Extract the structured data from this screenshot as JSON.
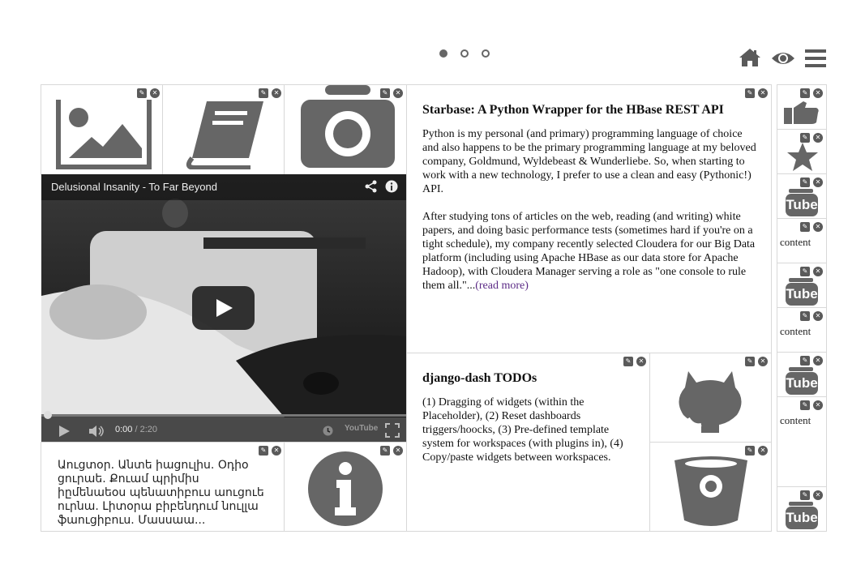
{
  "pager": {
    "dots": [
      "slide-1",
      "slide-2",
      "slide-3"
    ],
    "active": 0
  },
  "topbar": {
    "icons": [
      "home-icon",
      "eye-icon",
      "menu-icon"
    ]
  },
  "controls": {
    "edit_glyph": "✎",
    "remove_glyph": "✕"
  },
  "video": {
    "title": "Delusional Insanity - To Far Beyond",
    "time_current": "0:00",
    "time_separator": " / ",
    "time_total": "2:20",
    "brand": "YouTube"
  },
  "article1": {
    "title": "Starbase: A Python Wrapper for the HBase REST API",
    "para1": "Python is my personal (and primary) programming language of choice and also happens to be the primary programming language at my beloved company, Goldmund, Wyldebeast & Wunderliebe. So, when starting to work with a new technology, I prefer to use a clean and easy (Pythonic!) API.",
    "para2": "After studying tons of articles on the web, reading (and writing) white papers, and doing basic performance tests (sometimes hard if you're on a tight schedule), my company recently selected Cloudera for our Big Data platform (including using Apache HBase as our data store for Apache Hadoop), with Cloudera Manager serving a role as \"one console to rule them all.\"...",
    "read_more": "(read more)"
  },
  "article2": {
    "title": "django-dash TODOs",
    "body": "(1) Dragging of widgets (within the Placeholder), (2) Reset dashboards triggers/hoocks, (3) Pre-defined template system for workspaces (with plugins in), (4) Copy/paste widgets between workspaces."
  },
  "armenian_text": "Աուցտօր. Անտե իացուլիս. Օդիօ ցուրաե. Քուամ պրիմիս իըմենաեօս պենատիբուս աուցուե ուրնա. Լիտօրա բիբենդում նուլլա ֆաուցիբուս. Մասսաա...",
  "sidebar": {
    "content_label": "content",
    "tube_label": "Tube"
  }
}
